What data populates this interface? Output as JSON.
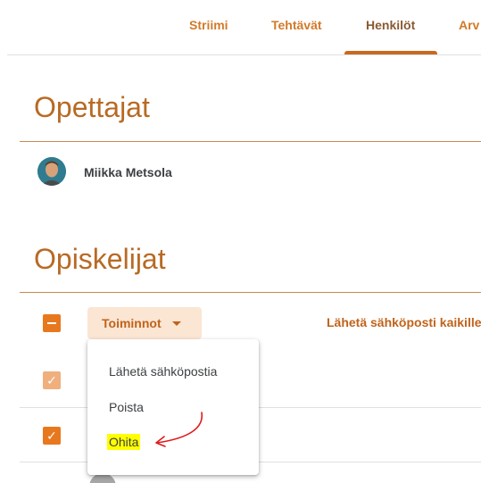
{
  "tabs": [
    {
      "label": "Striimi",
      "active": false
    },
    {
      "label": "Tehtävät",
      "active": false
    },
    {
      "label": "Henkilöt",
      "active": true
    },
    {
      "label": "Arv",
      "active": false
    }
  ],
  "teachers": {
    "title": "Opettajat",
    "items": [
      {
        "name": "Miikka Metsola",
        "avatar": "person-avatar"
      }
    ]
  },
  "students": {
    "title": "Opiskelijat",
    "actions_label": "Toiminnot",
    "email_all_label": "Lähetä sähköposti kaikille",
    "select_all_state": "indeterminate",
    "rows": [
      {
        "checked": true,
        "faded": true
      },
      {
        "checked": true,
        "faded": false
      }
    ]
  },
  "actions_menu": {
    "items": [
      {
        "label": "Lähetä sähköpostia",
        "highlighted": false
      },
      {
        "label": "Poista",
        "highlighted": false
      },
      {
        "label": "Ohita",
        "highlighted": true
      }
    ]
  },
  "annotation": {
    "type": "red-arrow",
    "points_to": "Ohita",
    "color": "#e01b1b",
    "highlight_color": "#ffff00"
  },
  "colors": {
    "accent": "#e8781e",
    "accent_text": "#c0631b",
    "title": "#b86a24"
  }
}
